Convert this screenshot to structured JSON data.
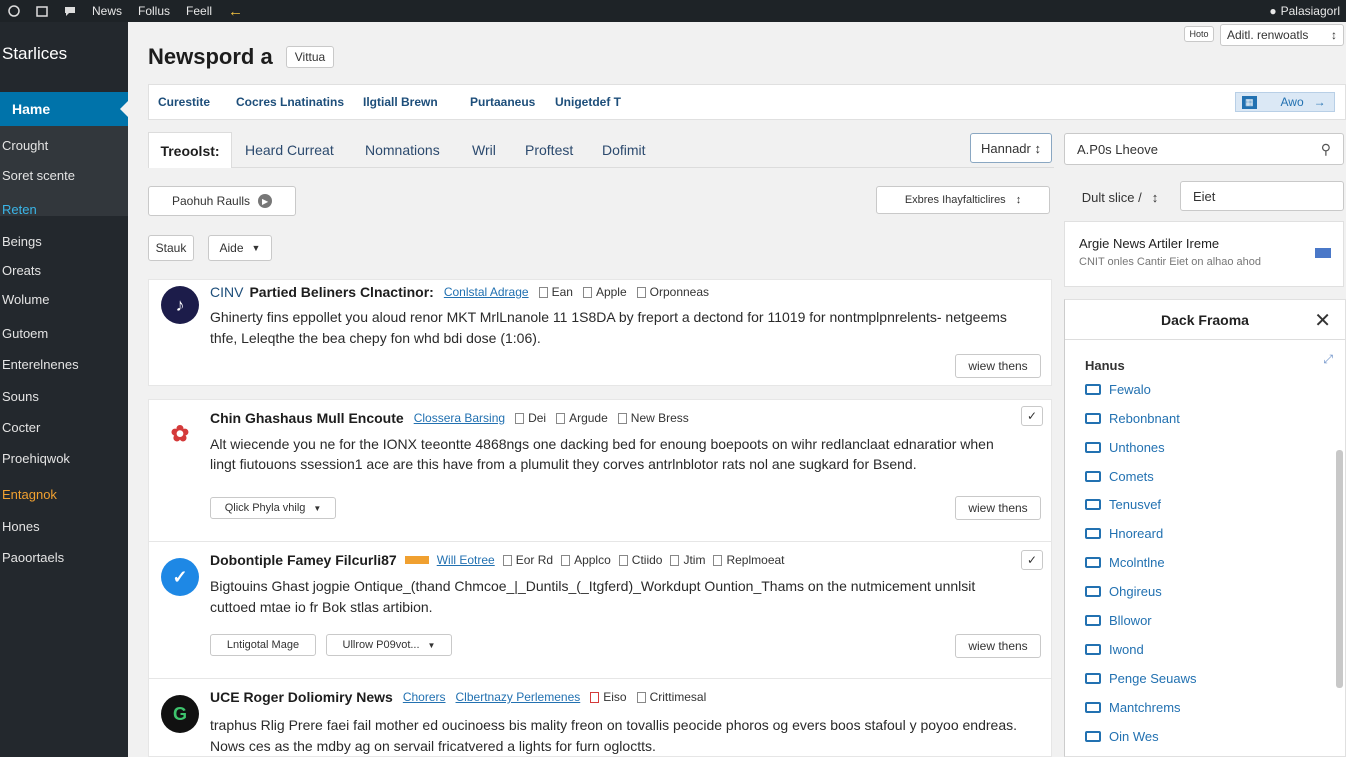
{
  "topbar": {
    "items": [
      "News",
      "Follus",
      "Feell"
    ],
    "right": "Palasiagorl"
  },
  "sidebar": {
    "title": "Starlices",
    "items": [
      {
        "label": "Hame",
        "style": "active"
      },
      {
        "label": "Crought"
      },
      {
        "label": "Soret scente"
      },
      {
        "label": "Reten",
        "style": "blue"
      },
      {
        "label": "Beings"
      },
      {
        "label": "Oreats"
      },
      {
        "label": "Wolume"
      },
      {
        "label": "Gutoem"
      },
      {
        "label": "Enterelnenes"
      },
      {
        "label": "Souns"
      },
      {
        "label": "Cocter"
      },
      {
        "label": "Proehiqwok"
      },
      {
        "label": "Entagnok",
        "style": "orange"
      },
      {
        "label": "Hones"
      },
      {
        "label": "Paoortaels"
      }
    ]
  },
  "header": {
    "title": "Newspord a",
    "badge": "Vittua",
    "top_right_small": "Hoto",
    "top_right_select": "Aditl. renwoatls"
  },
  "subnav": {
    "items": [
      "Curestite",
      "Cocres Lnatinatins",
      "Ilgtiall Brewn",
      "Purtaaneus",
      "Unigetdef T"
    ],
    "right_label": "Awo"
  },
  "tabs": {
    "items": [
      "Treoolst:",
      "Heard Curreat",
      "Nomnations",
      "Wril",
      "Proftest",
      "Dofimit"
    ],
    "button": "Hannadr"
  },
  "search": {
    "value": "A.P0s Lheove"
  },
  "filters": {
    "pill": "Paohuh Raulls",
    "select": "Exbres Ihayfalticlires",
    "btn1": "Stauk",
    "btn2": "Aide"
  },
  "right_panel": {
    "select_label": "Dult slice /",
    "input_value": "Eiet",
    "notice_title": "Argie News Artiler Ireme",
    "notice_text": "CNIT onles Cantir Eiet on alhao ahod",
    "box_title": "Dack Fraoma",
    "section": "Hanus",
    "items": [
      "Fewalo",
      "Rebonbnant",
      "Unthones",
      "Comets",
      "Tenusvef",
      "Hnoreard",
      "Mcolntlne",
      "Ohgireus",
      "Bllowor",
      "Iwond",
      "Penge Seuaws",
      "Mantchrems",
      "Oin Wes"
    ]
  },
  "articles": [
    {
      "prefix": "CINV",
      "title": "Partied Beliners Clnactinor:",
      "link": "Conlstal Adrage",
      "meta": [
        "Ean",
        "Apple",
        "Orponneas"
      ],
      "body": "Ghinerty fins eppollet you aloud renor MKT MrlLnanole 11 1S8DA by freport a dectond for 11019 for nontmplpnrelents- netgeems thfe, Leleqthe the bea chepy fon whd bdi dose (1:06).",
      "buttons": [],
      "view": "wiew thens",
      "avatar_color": "#1c1c4a",
      "avatar_glyph": "♪"
    },
    {
      "prefix": "",
      "title": "Chin Ghashaus Mull Encoute",
      "link": "Clossera Barsing",
      "meta": [
        "Dei",
        "Argude",
        "New Bress"
      ],
      "body": "Alt wiecende you ne for the IONX teeontte 4868ngs one dacking bed for enoung boepoots on wihr redlanclaat ednaratior when lingt fiutouons ssession1 ace are this have from a plumulit they corves antrlnblotor rats nol ane sugkard for Bsend.",
      "buttons": [
        "Qlick Phyla vhilg"
      ],
      "view": "wiew thens",
      "avatar_color": "#ffffff",
      "avatar_glyph": "✿"
    },
    {
      "prefix": "",
      "title": "Dobontiple Famey Filcurli87",
      "link": "Will Eotree",
      "meta": [
        "Eor Rd",
        "Applco",
        "Ctiido",
        "Jtim",
        "Replmoeat"
      ],
      "body": "Bigtouins Ghast jogpie Ontique_(thand Chmcoe_|_Duntils_(_Itgferd)_Workdupt Ountion_Thams on the nutmicement unnlsit cuttoed mtae io fr Bok stlas artibion.",
      "buttons": [
        "Lntigotal Mage",
        "Ullrow P09vot..."
      ],
      "view": "wiew thens",
      "avatar_color": "#1e88e5",
      "avatar_glyph": "✓"
    },
    {
      "prefix": "",
      "title": "UCE Roger Doliomiry News",
      "link": "Chorers",
      "link2": "Clbertnazy Perlemenes",
      "meta": [
        "Eiso",
        "Crittimesal"
      ],
      "body": "traphus Rlig Prere faei fail mother ed oucinoess bis mality freon on tovallis peocide phoros og evers boos stafoul y poyoo endreas. Nows ces as the mdby ag on servail fricatvered a lights for furn ogloctts.",
      "buttons": [],
      "view": "",
      "avatar_color": "#111111",
      "avatar_glyph": "G"
    }
  ]
}
